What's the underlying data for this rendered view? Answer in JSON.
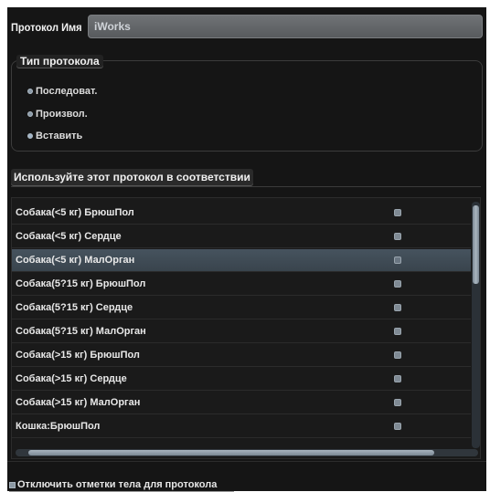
{
  "protocol_name": {
    "label": "Протокол Имя",
    "value": "iWorks"
  },
  "protocol_type": {
    "legend": "Тип протокола",
    "options": [
      {
        "label": "Последоват."
      },
      {
        "label": "Произвол."
      },
      {
        "label": "Вставить"
      }
    ]
  },
  "usage": {
    "header": "Используйте этот протокол в соответствии",
    "items": [
      {
        "label": "Собака(<5 кг) БрюшПол",
        "selected": false
      },
      {
        "label": "Собака(<5 кг) Сердце",
        "selected": false
      },
      {
        "label": "Собака(<5 кг) МалОрган",
        "selected": true
      },
      {
        "label": "Собака(5?15 кг) БрюшПол",
        "selected": false
      },
      {
        "label": "Собака(5?15 кг) Сердце",
        "selected": false
      },
      {
        "label": "Собака(5?15 кг) МалОрган",
        "selected": false
      },
      {
        "label": "Собака(>15 кг) БрюшПол",
        "selected": false
      },
      {
        "label": "Собака(>15 кг) Сердце",
        "selected": false
      },
      {
        "label": "Собака(>15 кг) МалОрган",
        "selected": false
      },
      {
        "label": "Кошка:БрюшПол",
        "selected": false
      }
    ]
  },
  "disable_body_marks": {
    "label": "Отключить отметки тела для протокола"
  },
  "colors": {
    "background": "#151515",
    "selection": "#3f4b55",
    "field": "#62666a"
  }
}
